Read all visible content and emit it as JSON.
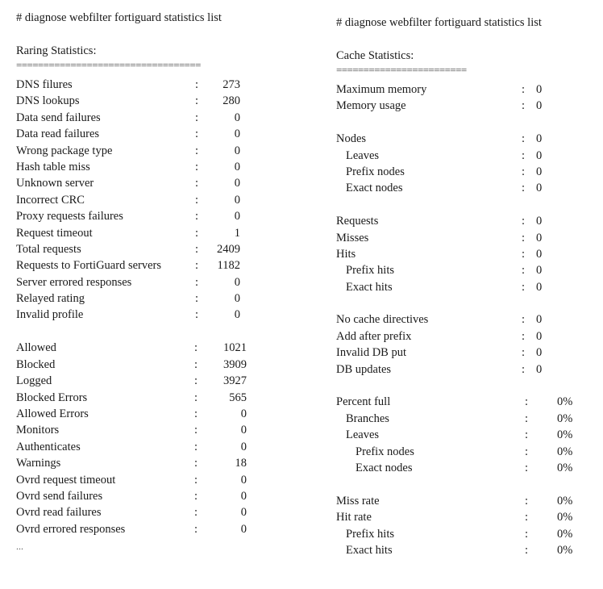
{
  "left": {
    "command": "# diagnose webfilter fortiguard statistics list",
    "heading": "Raring Statistics:",
    "rule": "==================================",
    "rows_a": [
      {
        "label": "DNS filures",
        "value": "273"
      },
      {
        "label": "DNS lookups",
        "value": "280"
      },
      {
        "label": "Data send failures",
        "value": "0"
      },
      {
        "label": "Data read failures",
        "value": "0"
      },
      {
        "label": "Wrong package type",
        "value": "0"
      },
      {
        "label": "Hash table miss",
        "value": "0"
      },
      {
        "label": "Unknown server",
        "value": "0"
      },
      {
        "label": "Incorrect CRC",
        "value": "0"
      },
      {
        "label": "Proxy requests failures",
        "value": "0"
      },
      {
        "label": "Request timeout",
        "value": "1"
      },
      {
        "label": "Total requests",
        "value": "2409"
      },
      {
        "label": "Requests to FortiGuard servers",
        "value": "1182"
      },
      {
        "label": "Server errored responses",
        "value": "0"
      },
      {
        "label": "Relayed rating",
        "value": "0"
      },
      {
        "label": "Invalid profile",
        "value": "0"
      }
    ],
    "rows_b": [
      {
        "label": "Allowed",
        "value": "1021"
      },
      {
        "label": "Blocked",
        "value": "3909"
      },
      {
        "label": "Logged",
        "value": "3927"
      },
      {
        "label": "Blocked Errors",
        "value": "565"
      },
      {
        "label": "Allowed Errors",
        "value": "0"
      },
      {
        "label": "Monitors",
        "value": "0"
      },
      {
        "label": "Authenticates",
        "value": "0"
      },
      {
        "label": "Warnings",
        "value": "18"
      },
      {
        "label": "Ovrd request timeout",
        "value": "0"
      },
      {
        "label": "Ovrd send failures",
        "value": "0"
      },
      {
        "label": "Ovrd read failures",
        "value": "0"
      },
      {
        "label": "Ovrd errored responses",
        "value": "0"
      }
    ],
    "ellipsis": "..."
  },
  "right": {
    "command": "# diagnose webfilter fortiguard statistics list",
    "heading": "Cache Statistics:",
    "rule": "========================",
    "groups": [
      [
        {
          "label": "Maximum memory",
          "value": "0",
          "indent": 0
        },
        {
          "label": "Memory usage",
          "value": "0",
          "indent": 0
        }
      ],
      [
        {
          "label": "Nodes",
          "value": "0",
          "indent": 0
        },
        {
          "label": "Leaves",
          "value": "0",
          "indent": 1
        },
        {
          "label": "Prefix nodes",
          "value": "0",
          "indent": 1
        },
        {
          "label": "Exact nodes",
          "value": "0",
          "indent": 1
        }
      ],
      [
        {
          "label": "Requests",
          "value": "0",
          "indent": 0
        },
        {
          "label": "Misses",
          "value": "0",
          "indent": 0
        },
        {
          "label": "Hits",
          "value": "0",
          "indent": 0
        },
        {
          "label": "Prefix hits",
          "value": "0",
          "indent": 1
        },
        {
          "label": "Exact hits",
          "value": "0",
          "indent": 1
        }
      ],
      [
        {
          "label": "No cache directives",
          "value": "0",
          "indent": 0
        },
        {
          "label": "Add after prefix",
          "value": "0",
          "indent": 0
        },
        {
          "label": "Invalid DB put",
          "value": "0",
          "indent": 0
        },
        {
          "label": "DB updates",
          "value": "0",
          "indent": 0
        }
      ],
      [
        {
          "label": "Percent full",
          "value": "0%",
          "indent": 0,
          "pct": true
        },
        {
          "label": "Branches",
          "value": "0%",
          "indent": 1,
          "pct": true
        },
        {
          "label": "Leaves",
          "value": "0%",
          "indent": 1,
          "pct": true
        },
        {
          "label": "Prefix nodes",
          "value": "0%",
          "indent": 2,
          "pct": true
        },
        {
          "label": "Exact nodes",
          "value": "0%",
          "indent": 2,
          "pct": true
        }
      ],
      [
        {
          "label": "Miss rate",
          "value": "0%",
          "indent": 0,
          "pct": true
        },
        {
          "label": "Hit rate",
          "value": "0%",
          "indent": 0,
          "pct": true
        },
        {
          "label": "Prefix hits",
          "value": "0%",
          "indent": 1,
          "pct": true
        },
        {
          "label": "Exact hits",
          "value": "0%",
          "indent": 1,
          "pct": true
        }
      ]
    ]
  },
  "separator": ":"
}
